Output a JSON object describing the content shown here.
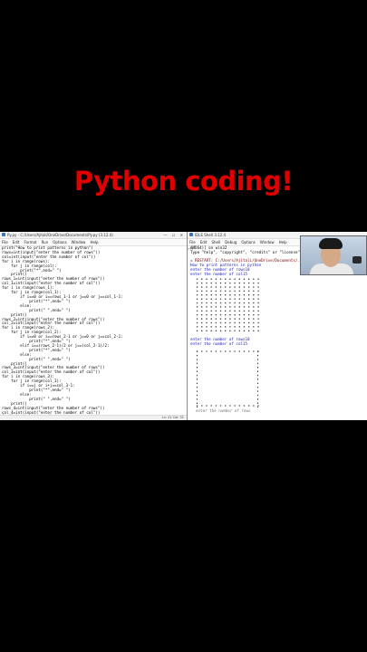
{
  "headline": "Python coding!",
  "editor": {
    "title": "Py.py - C:/Users/Ajitali/OneDrive/Documents/Py.py (3.12.4)",
    "menu": [
      "File",
      "Edit",
      "Format",
      "Run",
      "Options",
      "Window",
      "Help"
    ],
    "lines": [
      "print(\"How to print patterns in python\")",
      "rows=int(input(\"enter the number of rows\"))",
      "col=int(input(\"enter the number of col\"))",
      "for i in range(rows):",
      "    for j in range(col):",
      "        print(\"*\",end=\" \")",
      "    print()",
      "rows_1=int(input(\"enter the number of rows\"))",
      "col_1=int(input(\"enter the number of col\"))",
      "for i in range(rows_1):",
      "    for j in range(col_1):",
      "        if i==0 or i==rows_1-1 or j==0 or j==col_1-1:",
      "            print(\"*\",end=\" \")",
      "        else:",
      "            print(\" \",end=\" \")",
      "    print()",
      "rows_2=int(input(\"enter the number of rows\"))",
      "col_2=int(input(\"enter the number of col\"))",
      "for i in range(rows_2):",
      "    for j in range(col_2):",
      "        if i==0 or i==rows_2-1 or j==0 or j==col_2-1:",
      "            print(\"*\",end=\" \")",
      "        elif i==(rows_2-1)/2 or j==(col_2-1)/2:",
      "            print(\"*\",end=\" \")",
      "        else:",
      "            print(\" \",end=\" \")",
      "    print()",
      "rows_3=int(input(\"enter the number of rows\"))",
      "col_3=int(input(\"enter the number of col\"))",
      "for i in range(rows_3):",
      "    for j in range(col_3):",
      "        if i==j or i+j==col_3-1:",
      "            print(\"*\",end=\" \")",
      "        else:",
      "            print(\" \",end=\" \")",
      "    print()",
      "rows_4=int(input(\"enter the number of rows\"))",
      "col_4=int(input(\"enter the number of col\"))",
      "for i in range(rows_4):",
      "    for j in range(col_4):",
      "        if i==0 or j==rows_4-1 or..."
    ],
    "status": "Ln: 21  Col: 31"
  },
  "shell": {
    "title": "IDLE Shell 3.12.4",
    "menu": [
      "File",
      "Edit",
      "Shell",
      "Debug",
      "Options",
      "Window",
      "Help"
    ],
    "lines": [
      {
        "t": "AMD64)] on win32",
        "c": ""
      },
      {
        "t": "Type \"help\", \"copyright\", \"credits\" or \"license\"",
        "c": ""
      },
      {
        "t": "",
        "c": ""
      },
      {
        "t": "= RESTART: C:/Users/Ajitali/OneDrive/Documents/...",
        "c": "prompt"
      },
      {
        "t": "How to print patterns in python",
        "c": "blue"
      },
      {
        "t": "enter the number of rows10",
        "c": "blue"
      },
      {
        "t": "enter the number of col15",
        "c": "blue"
      }
    ],
    "lines2": [
      {
        "t": "enter the number of rows10",
        "c": "blue"
      },
      {
        "t": "enter the number of col15",
        "c": "blue"
      }
    ],
    "last": "enter the number of rows"
  }
}
